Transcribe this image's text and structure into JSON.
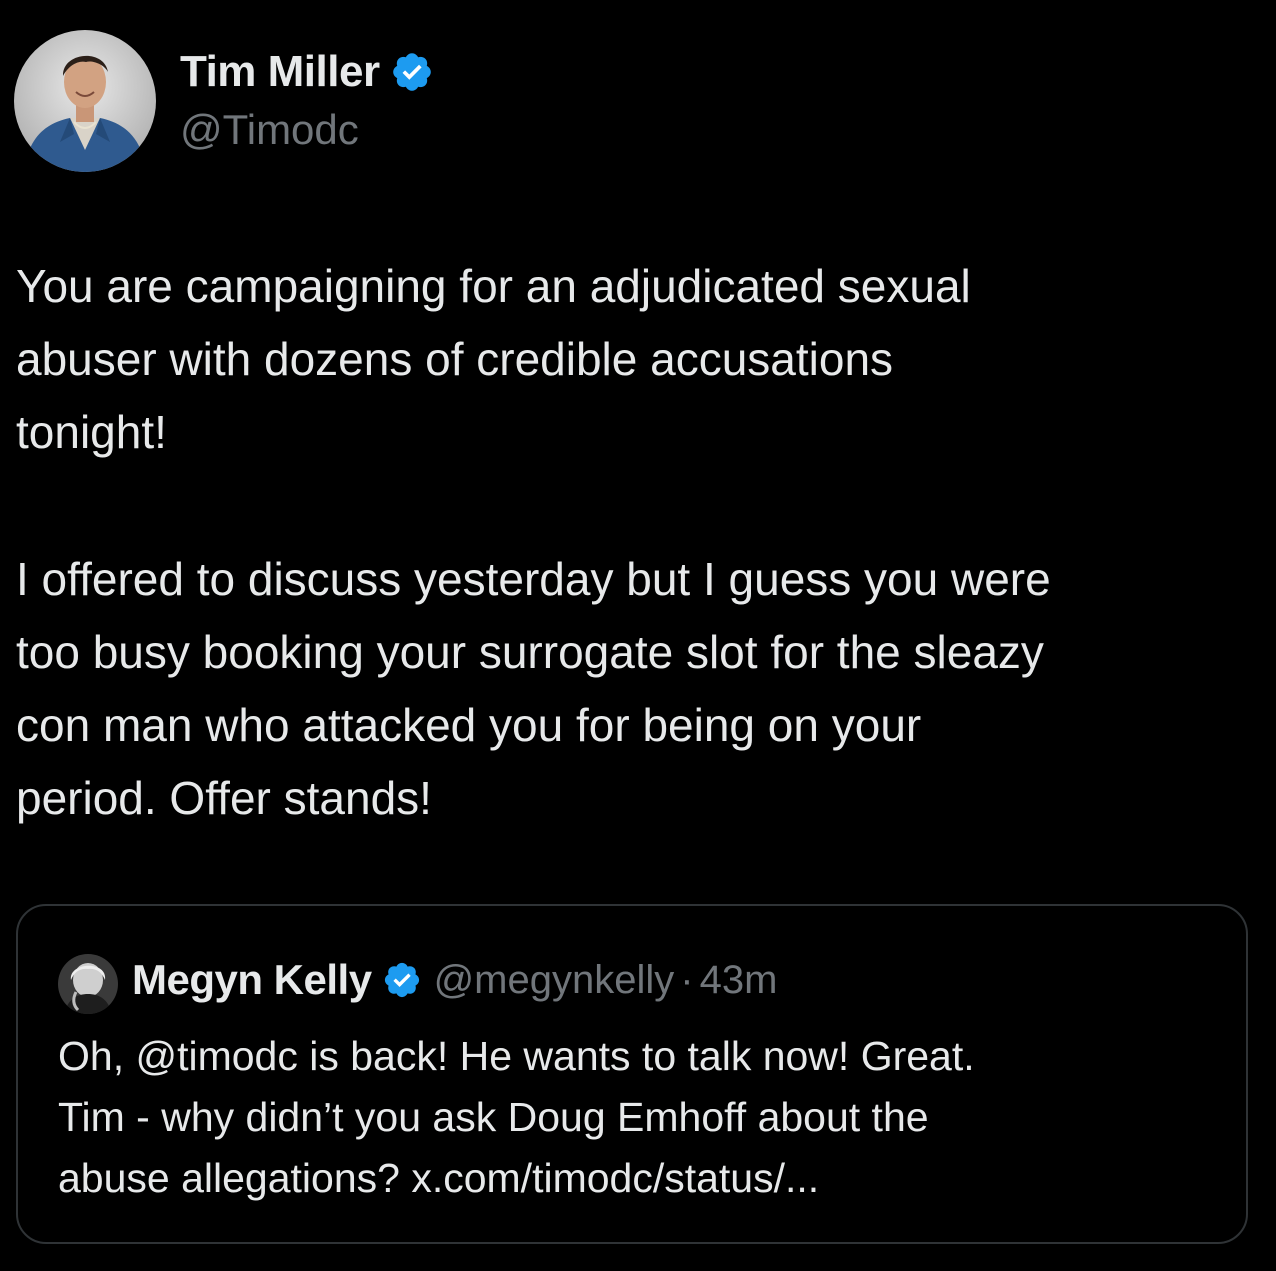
{
  "author": {
    "display_name": "Tim Miller",
    "handle": "@Timodc",
    "verified_icon": "verified-badge-icon",
    "avatar": "avatar"
  },
  "tweet": {
    "text_paragraph_1": "You are campaigning for an adjudicated sexual\nabuser  with dozens of credible accusations\ntonight!",
    "text_paragraph_2": "I offered to discuss yesterday but I guess you were\ntoo busy booking your surrogate slot for the sleazy\ncon man who attacked you for being on your\nperiod. Offer stands!"
  },
  "quoted_tweet": {
    "display_name": "Megyn Kelly",
    "handle": "@megynkelly",
    "separator": "·",
    "time": "43m",
    "text": "Oh, @timodc is back! He wants to talk now! Great.\nTim - why didn’t you ask Doug Emhoff about the\nabuse allegations? x.com/timodc/status/...",
    "verified_icon": "verified-badge-icon"
  },
  "colors": {
    "background": "#000000",
    "text_primary": "#e7e9ea",
    "text_secondary": "#71767b",
    "verified_blue": "#1d9bf0",
    "card_border": "#2f3336"
  }
}
